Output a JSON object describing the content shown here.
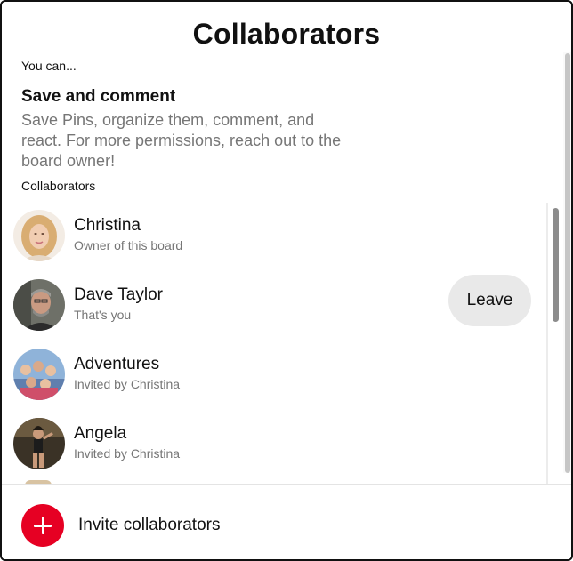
{
  "dialog": {
    "title": "Collaborators",
    "you_can": "You can...",
    "permission_title": "Save and comment",
    "permission_description": "Save Pins, organize them, comment, and react. For more permissions, reach out to the board owner!",
    "collaborators_heading": "Collaborators"
  },
  "collaborators": [
    {
      "name": "Christina",
      "subtitle": "Owner of this board",
      "avatar_icon": "christina-avatar"
    },
    {
      "name": "Dave Taylor",
      "subtitle": "That's you",
      "avatar_icon": "dave-avatar",
      "action_label": "Leave"
    },
    {
      "name": "Adventures",
      "subtitle": "Invited by Christina",
      "avatar_icon": "adventures-avatar"
    },
    {
      "name": "Angela",
      "subtitle": "Invited by Christina",
      "avatar_icon": "angela-avatar"
    }
  ],
  "footer": {
    "invite_label": "Invite collaborators",
    "invite_icon": "plus-icon"
  },
  "colors": {
    "accent_red": "#e60023",
    "secondary_text": "#767676",
    "button_gray": "#e9e9e9"
  }
}
